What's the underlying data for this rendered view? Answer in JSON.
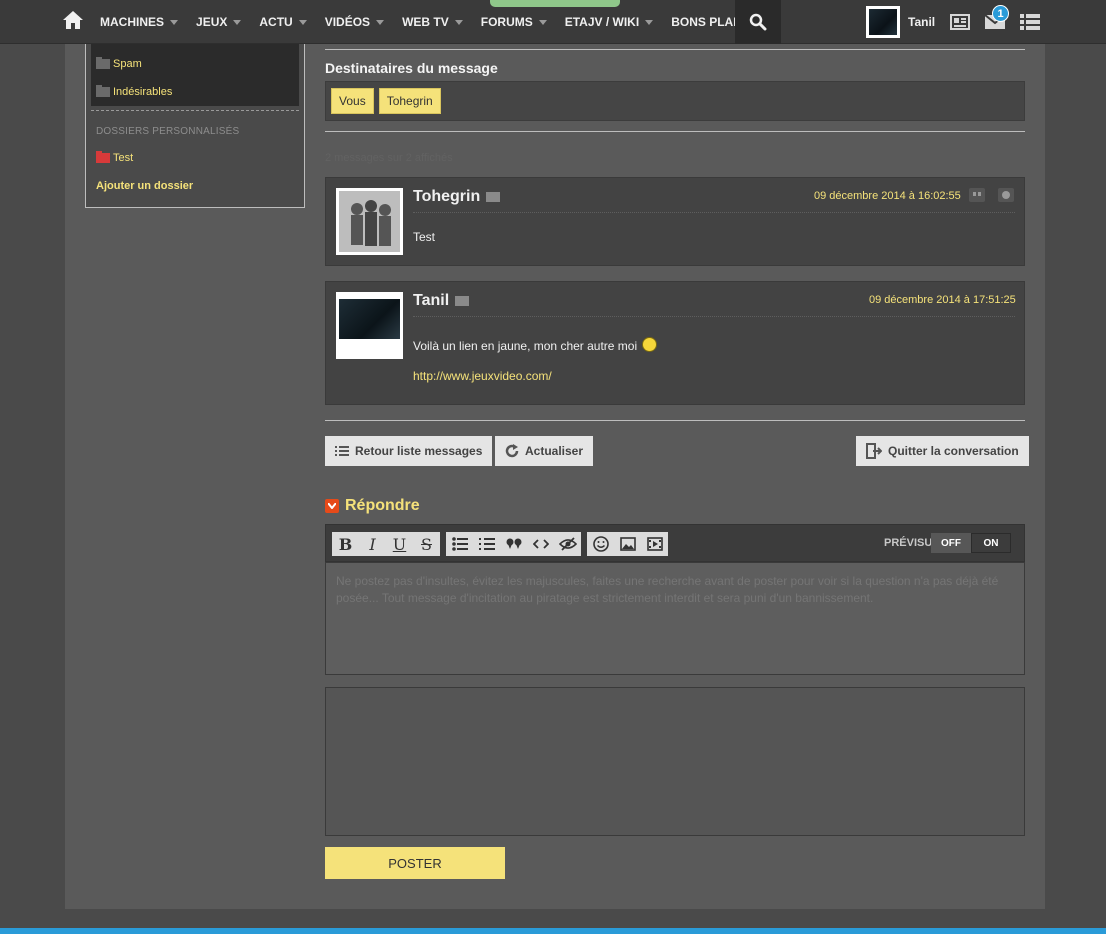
{
  "nav": {
    "items": [
      "MACHINES",
      "JEUX",
      "ACTU",
      "VIDÉOS",
      "WEB TV",
      "FORUMS",
      "ETAJV / WIKI",
      "BONS PLANS"
    ],
    "user": "Tanil",
    "mail_badge": "1"
  },
  "sidebar": {
    "items": [
      "Spam",
      "Indésirables"
    ],
    "heading": "DOSSIERS PERSONNALISÉS",
    "custom_folder": "Test",
    "add_folder": "Ajouter un dossier"
  },
  "recipients": {
    "title": "Destinataires du message",
    "chips": [
      "Vous",
      "Tohegrin"
    ]
  },
  "message_count": "2 messages sur 2 affichés",
  "messages": [
    {
      "author": "Tohegrin",
      "date": "09 décembre 2014 à 16:02:55",
      "body": "Test"
    },
    {
      "author": "Tanil",
      "date": "09 décembre 2014 à 17:51:25",
      "body": "Voilà un lien en jaune, mon cher autre moi",
      "link": "http://www.jeuxvideo.com/"
    }
  ],
  "actions": {
    "back": "Retour liste messages",
    "refresh": "Actualiser",
    "quit": "Quitter la conversation"
  },
  "reply": {
    "title": "Répondre",
    "preview_label": "PRÉVISU",
    "toggle_off": "OFF",
    "toggle_on": "ON",
    "placeholder": "Ne postez pas d'insultes, évitez les majuscules, faites une recherche avant de poster pour voir si la question n'a pas déjà été posée... Tout message d'incitation au piratage est strictement interdit et sera puni d'un bannissement.",
    "post_label": "POSTER"
  },
  "colors": {
    "accent": "#f5e27a",
    "badge": "#2a9bd8"
  }
}
